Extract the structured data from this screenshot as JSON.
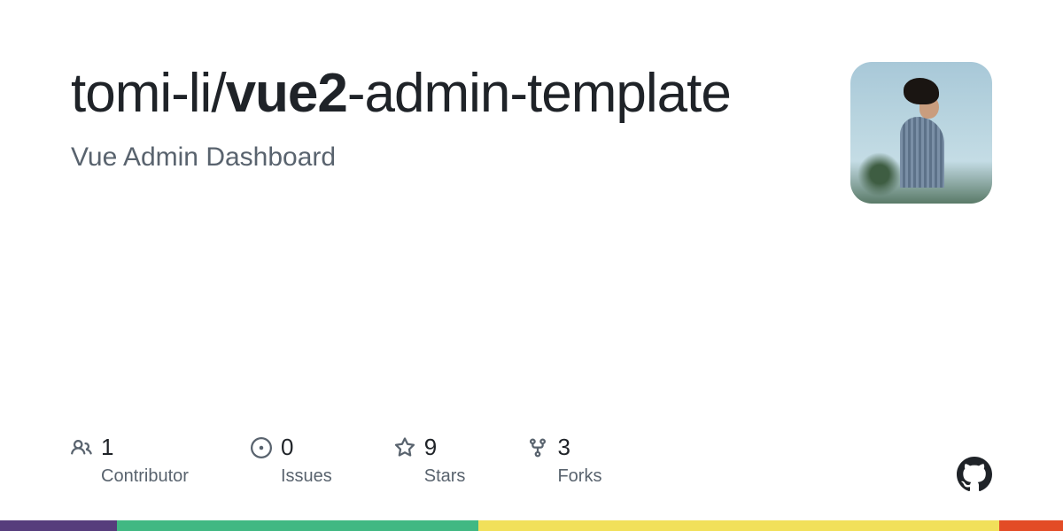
{
  "repo": {
    "owner": "tomi-li",
    "separator": "/",
    "name_part1": "vue2",
    "name_part2": "-admin-template",
    "description": "Vue Admin Dashboard"
  },
  "stats": {
    "contributors": {
      "count": "1",
      "label": "Contributor"
    },
    "issues": {
      "count": "0",
      "label": "Issues"
    },
    "stars": {
      "count": "9",
      "label": "Stars"
    },
    "forks": {
      "count": "3",
      "label": "Forks"
    }
  },
  "language_bar": [
    {
      "color": "#563d7c",
      "width": "11%"
    },
    {
      "color": "#41b883",
      "width": "34%"
    },
    {
      "color": "#f1e05a",
      "width": "49%"
    },
    {
      "color": "#e34c26",
      "width": "6%"
    }
  ]
}
